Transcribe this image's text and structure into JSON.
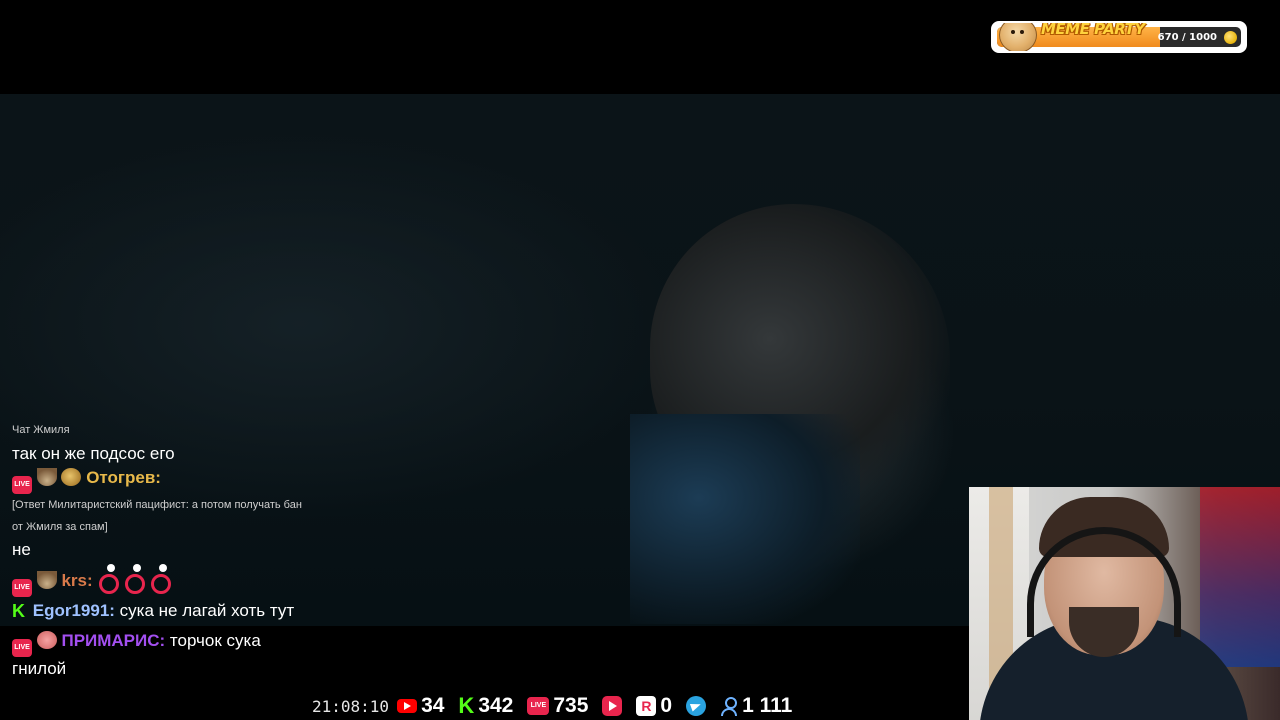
{
  "badge": {
    "title": "MEME PARTY",
    "progress": "670 / 1000",
    "progress_fraction": 0.67
  },
  "chat": {
    "title": "Чат Жмиля",
    "messages": [
      {
        "text": "так он же подсос его"
      },
      {
        "user": "Отогрев:",
        "user_color": "#e8b94a",
        "reply": "[Ответ Милитаристский пацифист: а потом получать бан от Жмиля за спам]",
        "text": "не"
      },
      {
        "user": "krs:",
        "user_color": "#d87a4a"
      },
      {
        "user": "Egor1991:",
        "user_color": "#9fc2ff",
        "text": "сука не лагай хоть тут"
      },
      {
        "user": "ПРИМАРИС:",
        "user_color": "#a34ff0",
        "text": "торчок сука гнилой"
      }
    ]
  },
  "status": {
    "time": "21:08:10",
    "youtube": "34",
    "kick": "342",
    "vk_live": "735",
    "rumble": "0",
    "viewers": "1 111"
  },
  "colors": {
    "live_red": "#e8254d",
    "kick_green": "#53fc18",
    "telegram_blue": "#2aa3e0"
  }
}
